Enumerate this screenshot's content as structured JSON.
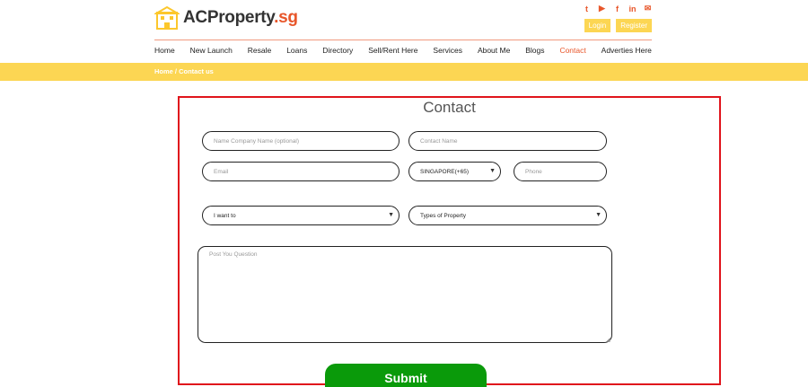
{
  "brand": {
    "name": "ACProperty",
    "suffix": ".sg"
  },
  "social": [
    {
      "icon": "twitter-icon",
      "glyph": "t"
    },
    {
      "icon": "youtube-icon",
      "glyph": "▶"
    },
    {
      "icon": "facebook-icon",
      "glyph": "f"
    },
    {
      "icon": "linkedin-icon",
      "glyph": "in"
    },
    {
      "icon": "mail-icon",
      "glyph": "✉"
    }
  ],
  "auth": {
    "login": "Login",
    "register": "Register"
  },
  "nav": [
    "Home",
    "New Launch",
    "Resale",
    "Loans",
    "Directory",
    "Sell/Rent Here",
    "Services",
    "About Me",
    "Blogs",
    "Contact",
    "Adverties Here"
  ],
  "nav_active": "Contact",
  "breadcrumb": "Home / Contact us",
  "form": {
    "title": "Contact",
    "name_placeholder": "Name Company Name (optional)",
    "contact_placeholder": "Contact Name",
    "email_placeholder": "Email",
    "country_code": "SINGAPORE(+65)",
    "phone_placeholder": "Phone",
    "want_to": "I want to",
    "property_type": "Types of Property",
    "question_placeholder": "Post You Question",
    "submit": "Submit"
  },
  "colors": {
    "accent": "#e8562a",
    "band": "#fcd653",
    "submit": "#0a9a0a",
    "frame": "#e0141c"
  }
}
